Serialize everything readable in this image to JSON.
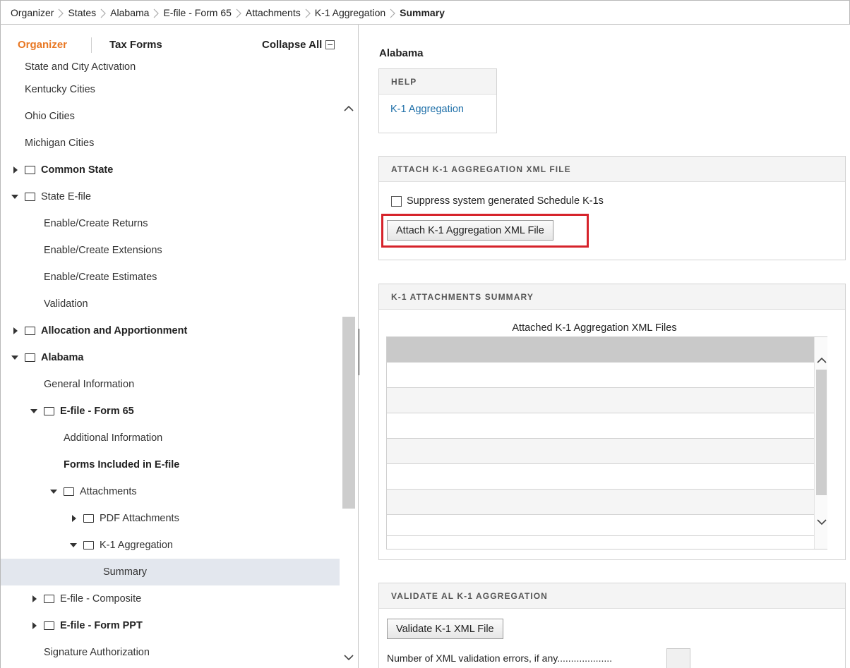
{
  "breadcrumb": {
    "items": [
      "Organizer",
      "States",
      "Alabama",
      "E-file - Form 65",
      "Attachments",
      "K-1 Aggregation",
      "Summary"
    ]
  },
  "sidebar": {
    "tabs": {
      "organizer": "Organizer",
      "tax_forms": "Tax Forms"
    },
    "collapse_all": "Collapse All",
    "accent_color": "#e87722",
    "items": [
      {
        "label": "State and City Activation",
        "cut_off": true
      },
      {
        "label": "Kentucky Cities"
      },
      {
        "label": "Ohio Cities"
      },
      {
        "label": "Michigan Cities"
      },
      {
        "label": "Common State",
        "bold": true,
        "expander": "collapsed",
        "folder": true
      },
      {
        "label": "State E-file",
        "expander": "expanded",
        "folder": true
      },
      {
        "label": "Enable/Create Returns"
      },
      {
        "label": "Enable/Create Extensions"
      },
      {
        "label": "Enable/Create Estimates"
      },
      {
        "label": "Validation"
      },
      {
        "label": "Allocation and Apportionment",
        "bold": true,
        "expander": "collapsed",
        "folder": true
      },
      {
        "label": "Alabama",
        "bold": true,
        "expander": "expanded",
        "folder": true
      },
      {
        "label": "General Information"
      },
      {
        "label": "E-file - Form 65",
        "bold": true,
        "expander": "expanded",
        "folder": true
      },
      {
        "label": "Additional Information"
      },
      {
        "label": "Forms Included in E-file",
        "bold": true
      },
      {
        "label": "Attachments",
        "expander": "expanded",
        "folder": true
      },
      {
        "label": "PDF Attachments",
        "expander": "collapsed",
        "folder": true
      },
      {
        "label": "K-1 Aggregation",
        "expander": "expanded",
        "folder": true
      },
      {
        "label": "Summary",
        "selected": true
      },
      {
        "label": "E-file - Composite",
        "expander": "collapsed",
        "folder": true
      },
      {
        "label": "E-file - Form PPT",
        "bold": true,
        "expander": "collapsed",
        "folder": true
      },
      {
        "label": "Signature Authorization"
      }
    ]
  },
  "main": {
    "title": "Alabama",
    "help": {
      "header": "HELP",
      "link": "K-1 Aggregation",
      "link_color": "#1e6fa8"
    },
    "attach": {
      "header": "ATTACH K-1 AGGREGATION XML FILE",
      "checkbox_label": "Suppress system generated Schedule K-1s",
      "checkbox_checked": false,
      "button": "Attach K-1 Aggregation XML File",
      "highlight_color": "#d6232b"
    },
    "summary": {
      "header": "K-1 ATTACHMENTS SUMMARY",
      "grid_title": "Attached K-1 Aggregation XML Files",
      "rows": [
        "",
        "",
        "",
        "",
        "",
        "",
        ""
      ]
    },
    "validate": {
      "header": "VALIDATE AL K-1 AGGREGATION",
      "button": "Validate K-1 XML File",
      "errors_label": "Number of XML validation errors, if any",
      "errors_value": ""
    }
  }
}
